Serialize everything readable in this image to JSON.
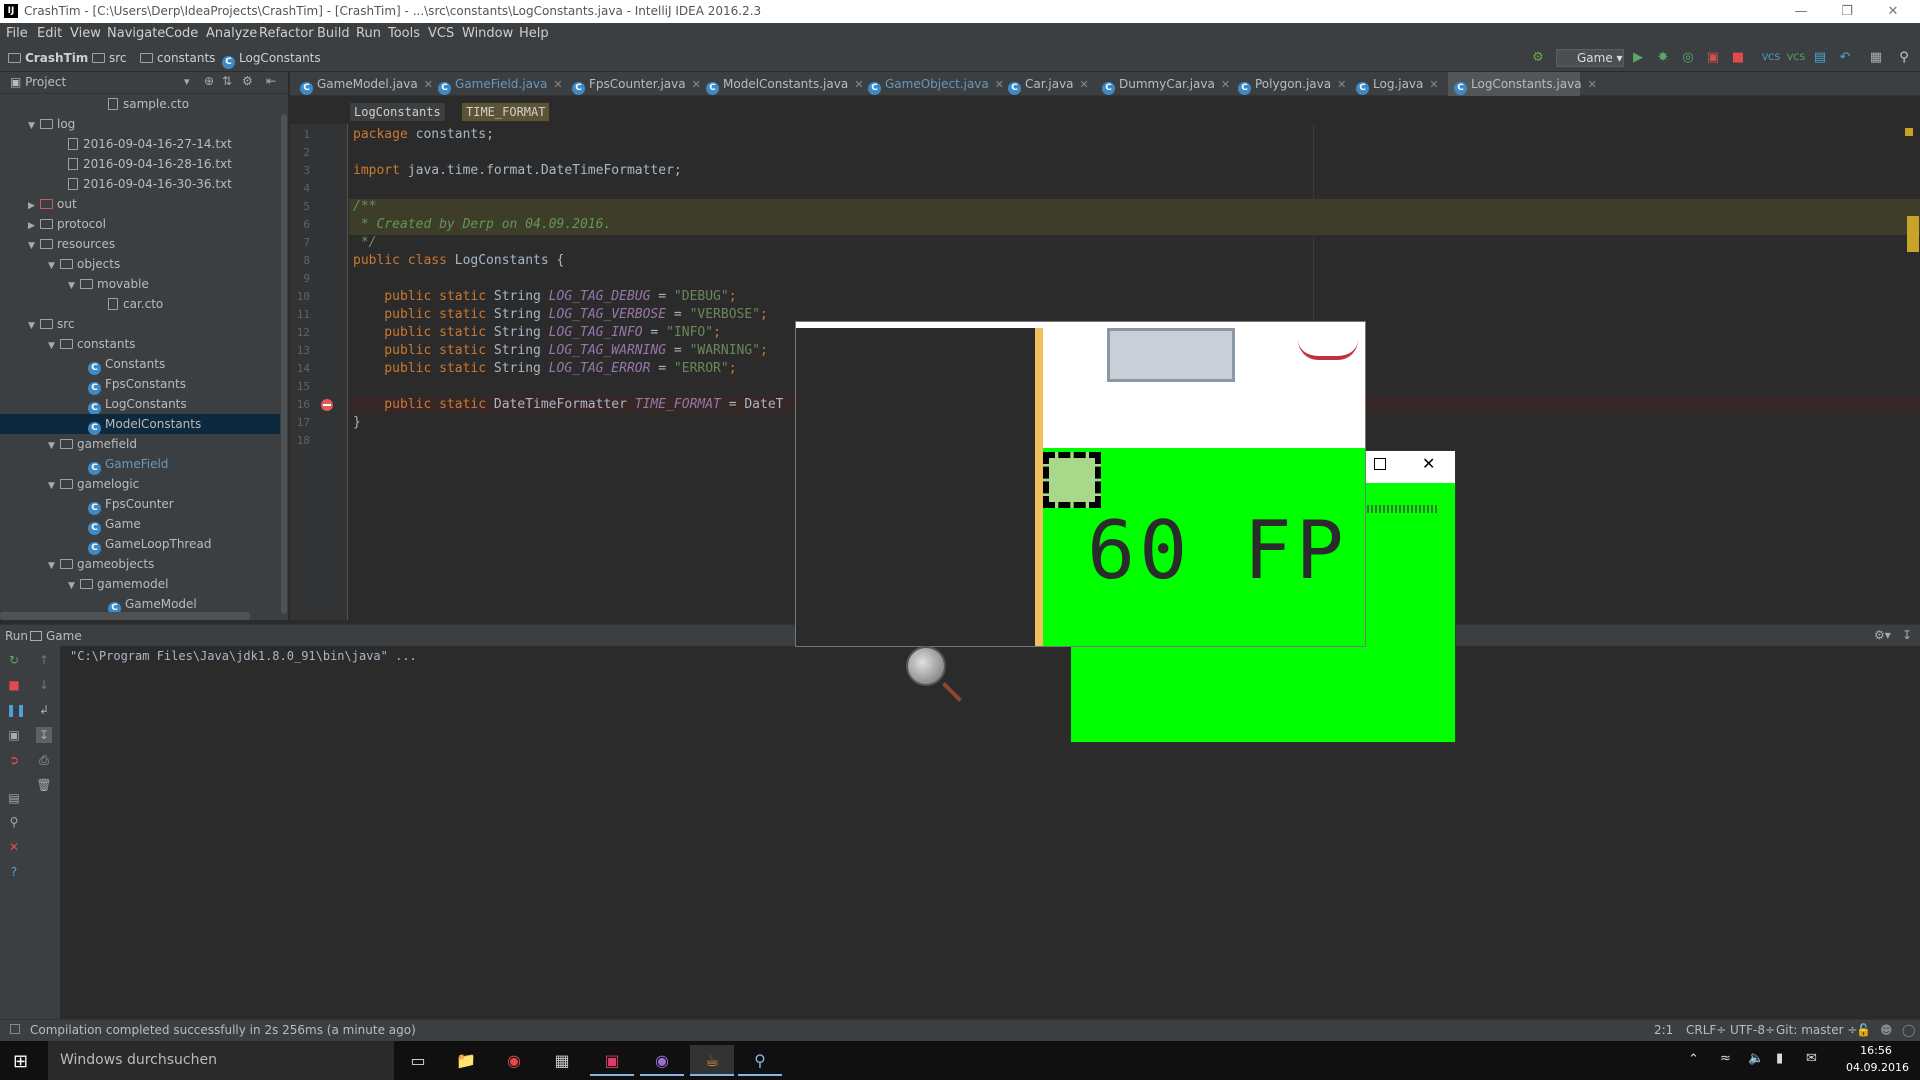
{
  "window": {
    "title": "CrashTim - [C:\\Users\\Derp\\IdeaProjects\\CrashTim] - [CrashTim] - ...\\src\\constants\\LogConstants.java - IntelliJ IDEA 2016.2.3"
  },
  "menu": [
    "File",
    "Edit",
    "View",
    "Navigate",
    "Code",
    "Analyze",
    "Refactor",
    "Build",
    "Run",
    "Tools",
    "VCS",
    "Window",
    "Help"
  ],
  "navbar": {
    "crumbs": [
      "CrashTim",
      "src",
      "constants",
      "LogConstants"
    ],
    "run_config": "Game"
  },
  "project_panel": {
    "title": "Project",
    "tree": [
      {
        "label": "sample.cto",
        "type": "file",
        "depth": 5
      },
      {
        "label": "log",
        "type": "folder",
        "depth": 1,
        "expanded": true
      },
      {
        "label": "2016-09-04-16-27-14.txt",
        "type": "file",
        "depth": 3
      },
      {
        "label": "2016-09-04-16-28-16.txt",
        "type": "file",
        "depth": 3
      },
      {
        "label": "2016-09-04-16-30-36.txt",
        "type": "file",
        "depth": 3
      },
      {
        "label": "out",
        "type": "folder-excluded",
        "depth": 1,
        "expanded": false
      },
      {
        "label": "protocol",
        "type": "folder",
        "depth": 1,
        "expanded": false
      },
      {
        "label": "resources",
        "type": "folder",
        "depth": 1,
        "expanded": true
      },
      {
        "label": "objects",
        "type": "folder",
        "depth": 2,
        "expanded": true
      },
      {
        "label": "movable",
        "type": "folder",
        "depth": 3,
        "expanded": true
      },
      {
        "label": "car.cto",
        "type": "file",
        "depth": 5
      },
      {
        "label": "src",
        "type": "folder",
        "depth": 1,
        "expanded": true
      },
      {
        "label": "constants",
        "type": "folder",
        "depth": 2,
        "expanded": true
      },
      {
        "label": "Constants",
        "type": "class",
        "depth": 4
      },
      {
        "label": "FpsConstants",
        "type": "class",
        "depth": 4
      },
      {
        "label": "LogConstants",
        "type": "class",
        "depth": 4
      },
      {
        "label": "ModelConstants",
        "type": "class",
        "depth": 4,
        "selected": true
      },
      {
        "label": "gamefield",
        "type": "folder",
        "depth": 2,
        "expanded": true
      },
      {
        "label": "GameField",
        "type": "class",
        "depth": 4,
        "modified": true
      },
      {
        "label": "gamelogic",
        "type": "folder",
        "depth": 2,
        "expanded": true
      },
      {
        "label": "FpsCounter",
        "type": "class",
        "depth": 4
      },
      {
        "label": "Game",
        "type": "class",
        "depth": 4
      },
      {
        "label": "GameLoopThread",
        "type": "class",
        "depth": 4
      },
      {
        "label": "gameobjects",
        "type": "folder",
        "depth": 2,
        "expanded": true
      },
      {
        "label": "gamemodel",
        "type": "folder",
        "depth": 3,
        "expanded": true
      },
      {
        "label": "GameModel",
        "type": "class",
        "depth": 5
      }
    ]
  },
  "tabs": [
    {
      "label": "GameModel.java"
    },
    {
      "label": "GameField.java",
      "modified": true
    },
    {
      "label": "FpsCounter.java"
    },
    {
      "label": "ModelConstants.java"
    },
    {
      "label": "GameObject.java",
      "modified": true
    },
    {
      "label": "Car.java"
    },
    {
      "label": "DummyCar.java"
    },
    {
      "label": "Polygon.java"
    },
    {
      "label": "Log.java"
    },
    {
      "label": "LogConstants.java",
      "active": true
    }
  ],
  "editor": {
    "breadcrumbs": [
      "LogConstants",
      "TIME_FORMAT"
    ],
    "line_numbers": [
      "1",
      "2",
      "3",
      "4",
      "5",
      "6",
      "7",
      "8",
      "9",
      "10",
      "11",
      "12",
      "13",
      "14",
      "15",
      "16",
      "17",
      "18"
    ],
    "lines": [
      [
        {
          "t": "package ",
          "c": "kw"
        },
        {
          "t": "constants;",
          "c": ""
        }
      ],
      [],
      [
        {
          "t": "import ",
          "c": "kw"
        },
        {
          "t": "java.time.format.DateTimeFormatter;",
          "c": ""
        }
      ],
      [],
      [
        {
          "t": "/**",
          "c": "cmt"
        }
      ],
      [
        {
          "t": " * Created by Derp on 04.09.2016.",
          "c": "cmt"
        }
      ],
      [
        {
          "t": " */",
          "c": "cmt"
        }
      ],
      [
        {
          "t": "public class ",
          "c": "kw"
        },
        {
          "t": "LogConstants {",
          "c": ""
        }
      ],
      [],
      [
        {
          "t": "    public static ",
          "c": "kw"
        },
        {
          "t": "String ",
          "c": ""
        },
        {
          "t": "LOG_TAG_DEBUG",
          "c": "fld"
        },
        {
          "t": " = ",
          "c": ""
        },
        {
          "t": "\"DEBUG\"",
          "c": "str"
        },
        {
          "t": ";",
          "c": "kw"
        }
      ],
      [
        {
          "t": "    public static ",
          "c": "kw"
        },
        {
          "t": "String ",
          "c": ""
        },
        {
          "t": "LOG_TAG_VERBOSE",
          "c": "fld"
        },
        {
          "t": " = ",
          "c": ""
        },
        {
          "t": "\"VERBOSE\"",
          "c": "str"
        },
        {
          "t": ";",
          "c": "kw"
        }
      ],
      [
        {
          "t": "    public static ",
          "c": "kw"
        },
        {
          "t": "String ",
          "c": ""
        },
        {
          "t": "LOG_TAG_INFO",
          "c": "fld"
        },
        {
          "t": " = ",
          "c": ""
        },
        {
          "t": "\"INFO\"",
          "c": "str"
        },
        {
          "t": ";",
          "c": "kw"
        }
      ],
      [
        {
          "t": "    public static ",
          "c": "kw"
        },
        {
          "t": "String ",
          "c": ""
        },
        {
          "t": "LOG_TAG_WARNING",
          "c": "fld"
        },
        {
          "t": " = ",
          "c": ""
        },
        {
          "t": "\"WARNING\"",
          "c": "str"
        },
        {
          "t": ";",
          "c": "kw"
        }
      ],
      [
        {
          "t": "    public static ",
          "c": "kw"
        },
        {
          "t": "String ",
          "c": ""
        },
        {
          "t": "LOG_TAG_ERROR",
          "c": "fld"
        },
        {
          "t": " = ",
          "c": ""
        },
        {
          "t": "\"ERROR\"",
          "c": "str"
        },
        {
          "t": ";",
          "c": "kw"
        }
      ],
      [],
      [
        {
          "t": "    public static ",
          "c": "kw"
        },
        {
          "t": "DateTimeFormatter ",
          "c": ""
        },
        {
          "t": "TIME_FORMAT",
          "c": "fld"
        },
        {
          "t": " = DateT",
          "c": ""
        }
      ],
      [
        {
          "t": "}",
          "c": ""
        }
      ],
      []
    ]
  },
  "run_panel": {
    "label": "Run",
    "config": "Game",
    "output": "\"C:\\Program Files\\Java\\jdk1.8.0_91\\bin\\java\" ..."
  },
  "game_window": {
    "fps_text": "60 FP"
  },
  "status": {
    "message": "Compilation completed successfully in 2s 256ms (a minute ago)",
    "position": "2:1",
    "line_sep": "CRLF÷",
    "encoding": "UTF-8÷",
    "vcs": "Git: master ÷"
  },
  "taskbar": {
    "search_placeholder": "Windows durchsuchen",
    "time": "16:56",
    "date": "04.09.2016"
  },
  "colors": {
    "keyword": "#cc7832",
    "string": "#6a8759",
    "field": "#9876aa",
    "comment": "#629755",
    "game_green": "#00ff00"
  }
}
